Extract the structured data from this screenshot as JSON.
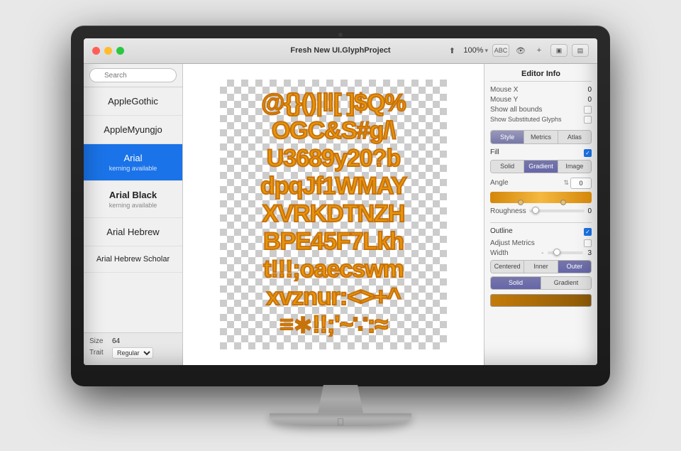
{
  "monitor": {
    "camera_alt": "camera"
  },
  "titlebar": {
    "title": "Fresh New UI.GlyphProject",
    "zoom": "100%",
    "traffic": {
      "close": "close",
      "minimize": "minimize",
      "maximize": "maximize"
    }
  },
  "toolbar": {
    "share_label": "⬆",
    "zoom_label": "100%",
    "zoom_arrow": "▾",
    "abc_label": "ABC",
    "eye_label": "👁",
    "plus_label": "+",
    "layout1_label": "▣",
    "layout2_label": "▤"
  },
  "sidebar": {
    "search_placeholder": "Search",
    "fonts": [
      {
        "name": "AppleGothic",
        "sub": "",
        "selected": false,
        "bold": false
      },
      {
        "name": "AppleMyungjo",
        "sub": "",
        "selected": false,
        "bold": false
      },
      {
        "name": "Arial",
        "sub": "kerning available",
        "selected": true,
        "bold": false
      },
      {
        "name": "Arial Black",
        "sub": "kerning available",
        "selected": false,
        "bold": true
      },
      {
        "name": "Arial Hebrew",
        "sub": "",
        "selected": false,
        "bold": false
      },
      {
        "name": "Arial Hebrew Scholar",
        "sub": "",
        "selected": false,
        "bold": false
      }
    ],
    "size_label": "Size",
    "size_value": "64",
    "trait_label": "Trait",
    "trait_value": "Regular"
  },
  "canvas": {
    "glyph_lines": [
      "@{}()|‖[  ]$Q%",
      "OGC&S#g/\\",
      "U3689y20?b",
      "dpqJf1WMAY",
      "XVRKDTNZH",
      "BPE45F7Lkh",
      "t‼‼‼;oaecswm",
      "xvznur:<>+^",
      "≡∗‼;;'~∵:≈"
    ]
  },
  "right_panel": {
    "title": "Editor Info",
    "mouse_x_label": "Mouse X",
    "mouse_x_value": "0",
    "mouse_y_label": "Mouse Y",
    "mouse_y_value": "0",
    "show_bounds_label": "Show all bounds",
    "show_substituted_label": "Show Substituted Glyphs",
    "tabs": [
      {
        "label": "Style",
        "active": true
      },
      {
        "label": "Metrics",
        "active": false
      },
      {
        "label": "Atlas",
        "active": false
      }
    ],
    "fill_section": {
      "label": "Fill",
      "checkbox_checked": true,
      "fill_tabs": [
        {
          "label": "Solid",
          "active": false
        },
        {
          "label": "Gradient",
          "active": true
        },
        {
          "label": "Image",
          "active": false
        }
      ],
      "angle_label": "Angle",
      "angle_value": "0",
      "roughness_label": "Roughness",
      "roughness_value": "0"
    },
    "outline_section": {
      "label": "Outline",
      "checkbox_checked": true,
      "adjust_metrics_label": "Adjust Metrics",
      "adjust_checked": false,
      "width_label": "Width",
      "width_minus": "-",
      "width_value": "3",
      "type_tabs": [
        {
          "label": "Centered",
          "active": false
        },
        {
          "label": "Inner",
          "active": false
        },
        {
          "label": "Outer",
          "active": true
        }
      ],
      "style_tabs": [
        {
          "label": "Solid",
          "active": true
        },
        {
          "label": "Gradient",
          "active": false
        }
      ]
    }
  }
}
